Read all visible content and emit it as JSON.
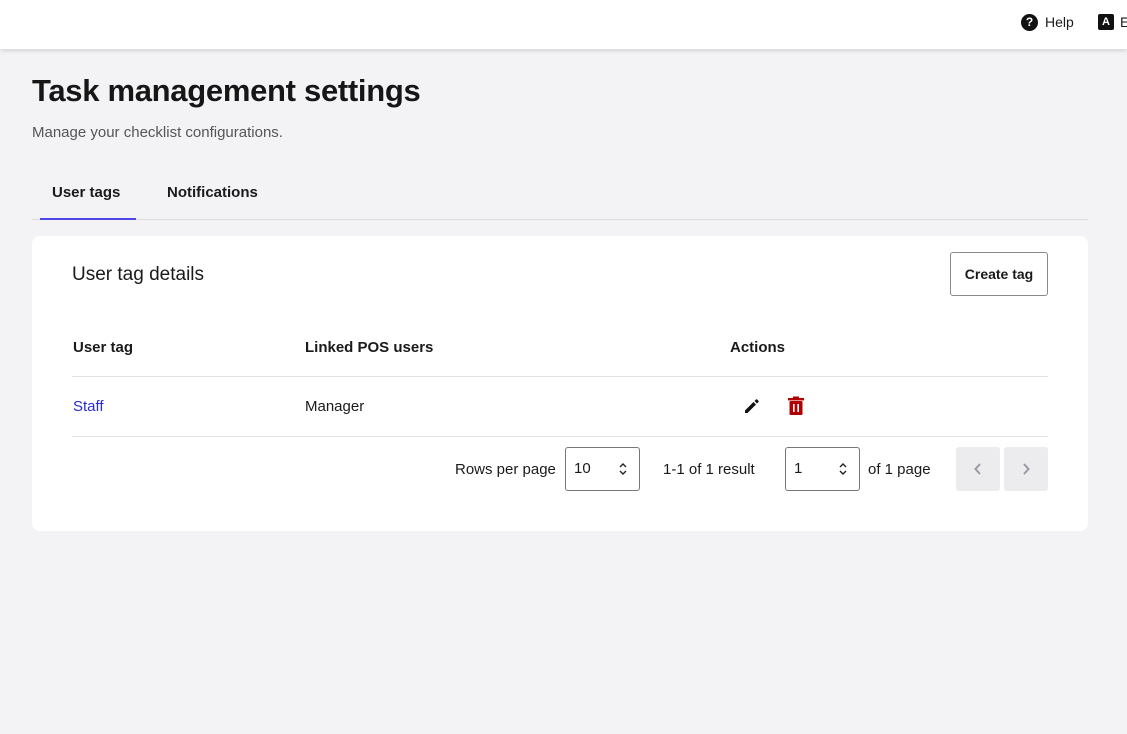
{
  "topbar": {
    "help_label": "Help",
    "help_icon": "question-circle-icon",
    "lang_label": "E",
    "lang_icon": "language-icon"
  },
  "page": {
    "title": "Task management settings",
    "subtitle": "Manage your checklist configurations."
  },
  "tabs": [
    {
      "label": "User tags",
      "active": true
    },
    {
      "label": "Notifications",
      "active": false
    }
  ],
  "card": {
    "title": "User tag details",
    "create_button": "Create tag",
    "columns": [
      "User tag",
      "Linked POS users",
      "Actions"
    ],
    "rows": [
      {
        "user_tag": "Staff",
        "linked_pos_users": "Manager",
        "actions": [
          "pencil-icon",
          "trash-icon"
        ]
      }
    ]
  },
  "pagination": {
    "rows_per_page_label": "Rows per page",
    "rows_per_page": "10",
    "result_text": "1-1 of 1 result",
    "page": "1",
    "page_total_text": "of 1 page"
  },
  "colors": {
    "accent": "#4f46e5",
    "link": "#2b2bd1",
    "delete": "#b00000",
    "background": "#f3f3f6"
  }
}
